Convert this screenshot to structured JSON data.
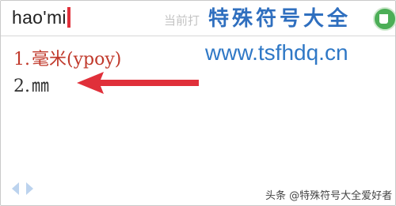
{
  "input": {
    "pinyin": "hao'mi",
    "hint": "当前打"
  },
  "overlay": {
    "brand_name": "特殊符号大全",
    "brand_url": "www.tsfhdq.cn"
  },
  "candidates": [
    {
      "number": "1.",
      "text": "毫米(ypoy)"
    },
    {
      "number": "2.",
      "text": "㎜"
    }
  ],
  "icons": {
    "badge": "app-badge-icon",
    "arrow": "red-arrow-icon",
    "prev": "prev-page-icon",
    "next": "next-page-icon"
  },
  "colors": {
    "candidate_highlight": "#c0392b",
    "brand": "#2f6fbf",
    "arrow": "#e0303a"
  },
  "footer": {
    "watermark": "头条 @特殊符号大全爱好者"
  }
}
